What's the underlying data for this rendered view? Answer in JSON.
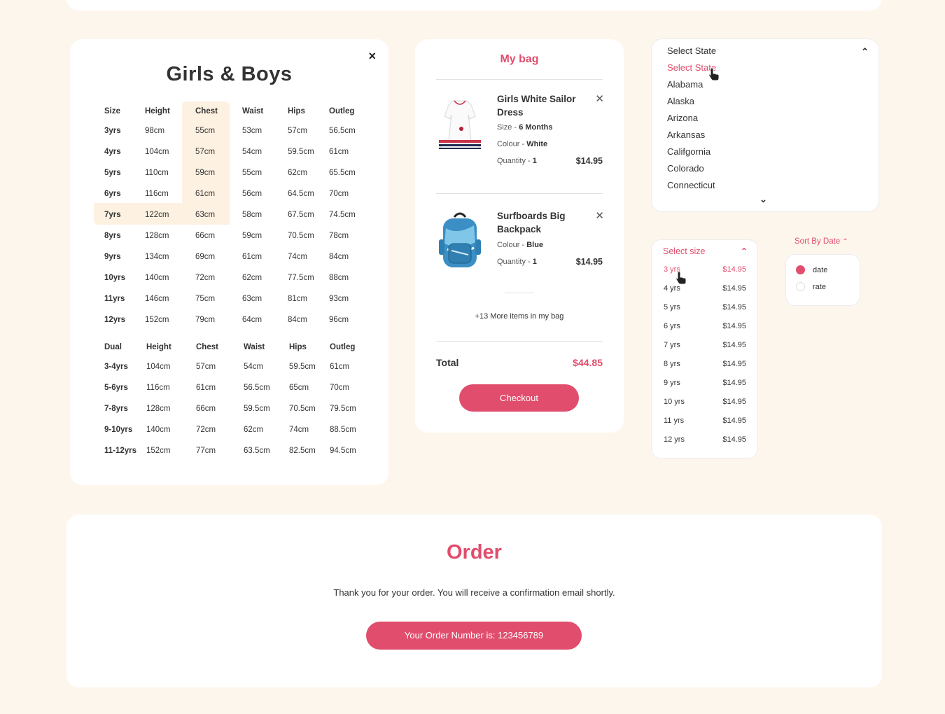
{
  "size_chart": {
    "title": "Girls & Boys",
    "close_icon": "×",
    "headers": [
      "Size",
      "Height",
      "Chest",
      "Waist",
      "Hips",
      "Outleg"
    ],
    "rows": [
      [
        "3yrs",
        "98cm",
        "55cm",
        "53cm",
        "57cm",
        "56.5cm"
      ],
      [
        "4yrs",
        "104cm",
        "57cm",
        "54cm",
        "59.5cm",
        "61cm"
      ],
      [
        "5yrs",
        "110cm",
        "59cm",
        "55cm",
        "62cm",
        "65.5cm"
      ],
      [
        "6yrs",
        "116cm",
        "61cm",
        "56cm",
        "64.5cm",
        "70cm"
      ],
      [
        "7yrs",
        "122cm",
        "63cm",
        "58cm",
        "67.5cm",
        "74.5cm"
      ],
      [
        "8yrs",
        "128cm",
        "66cm",
        "59cm",
        "70.5cm",
        "78cm"
      ],
      [
        "9yrs",
        "134cm",
        "69cm",
        "61cm",
        "74cm",
        "84cm"
      ],
      [
        "10yrs",
        "140cm",
        "72cm",
        "62cm",
        "77.5cm",
        "88cm"
      ],
      [
        "11yrs",
        "146cm",
        "75cm",
        "63cm",
        "81cm",
        "93cm"
      ],
      [
        "12yrs",
        "152cm",
        "79cm",
        "64cm",
        "84cm",
        "96cm"
      ]
    ],
    "dual_headers": [
      "Dual",
      "Height",
      "Chest",
      "Waist",
      "Hips",
      "Outleg"
    ],
    "dual_rows": [
      [
        "3-4yrs",
        "104cm",
        "57cm",
        "54cm",
        "59.5cm",
        "61cm"
      ],
      [
        "5-6yrs",
        "116cm",
        "61cm",
        "56.5cm",
        "65cm",
        "70cm"
      ],
      [
        "7-8yrs",
        "128cm",
        "66cm",
        "59.5cm",
        "70.5cm",
        "79.5cm"
      ],
      [
        "9-10yrs",
        "140cm",
        "72cm",
        "62cm",
        "74cm",
        "88.5cm"
      ],
      [
        "11-12yrs",
        "152cm",
        "77cm",
        "63.5cm",
        "82.5cm",
        "94.5cm"
      ]
    ]
  },
  "bag": {
    "title": "My bag",
    "items": [
      {
        "name": "Girls White Sailor Dress",
        "size_label": "Size -",
        "size_value": "6 Months",
        "colour_label": "Colour -",
        "colour_value": "White",
        "quantity_label": "Quantity -",
        "quantity_value": "1",
        "price": "$14.95",
        "remove_icon": "✕"
      },
      {
        "name": "Surfboards Big Backpack",
        "colour_label": "Colour -",
        "colour_value": "Blue",
        "quantity_label": "Quantity -",
        "quantity_value": "1",
        "price": "$14.95",
        "remove_icon": "✕"
      }
    ],
    "more_items": "+13 More items in my bag",
    "total_label": "Total",
    "total_value": "$44.85",
    "checkout_label": "Checkout"
  },
  "state_select": {
    "selected": "Select State",
    "options": [
      "Select State",
      "Alabama",
      "Alaska",
      "Arizona",
      "Arkansas",
      "Califgornia",
      "Colorado",
      "Connecticut"
    ]
  },
  "size_select": {
    "placeholder": "Select size",
    "options": [
      {
        "size": "3 yrs",
        "price": "$14.95"
      },
      {
        "size": "4 yrs",
        "price": "$14.95"
      },
      {
        "size": "5 yrs",
        "price": "$14.95"
      },
      {
        "size": "6 yrs",
        "price": "$14.95"
      },
      {
        "size": "7 yrs",
        "price": "$14.95"
      },
      {
        "size": "8 yrs",
        "price": "$14.95"
      },
      {
        "size": "9 yrs",
        "price": "$14.95"
      },
      {
        "size": "10 yrs",
        "price": "$14.95"
      },
      {
        "size": "11 yrs",
        "price": "$14.95"
      },
      {
        "size": "12 yrs",
        "price": "$14.95"
      }
    ]
  },
  "sort": {
    "label": "Sort By Date",
    "options": [
      "date",
      "rate"
    ]
  },
  "order": {
    "title": "Order",
    "message": "Thank you for your order. You will receive a confirmation email shortly.",
    "order_number": "Your Order Number is: 123456789"
  },
  "colors": {
    "accent": "#e14d6c",
    "background": "#fdf6ec",
    "highlight": "#fdf1e2"
  }
}
